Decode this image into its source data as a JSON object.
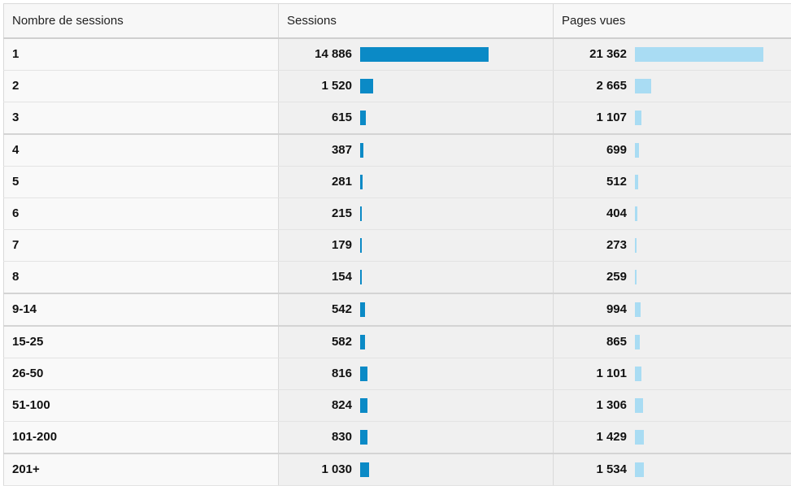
{
  "colors": {
    "sessions_bar": "#0b8ac6",
    "pageviews_bar": "#a9dcf3"
  },
  "table": {
    "headers": [
      "Nombre de sessions",
      "Sessions",
      "Pages vues"
    ],
    "rows": [
      {
        "label": "1",
        "sessions": "14 886",
        "sessions_value": 14886,
        "pageviews": "21 362",
        "pageviews_value": 21362
      },
      {
        "label": "2",
        "sessions": "1 520",
        "sessions_value": 1520,
        "pageviews": "2 665",
        "pageviews_value": 2665
      },
      {
        "label": "3",
        "sessions": "615",
        "sessions_value": 615,
        "pageviews": "1 107",
        "pageviews_value": 1107
      },
      {
        "label": "4",
        "sessions": "387",
        "sessions_value": 387,
        "pageviews": "699",
        "pageviews_value": 699
      },
      {
        "label": "5",
        "sessions": "281",
        "sessions_value": 281,
        "pageviews": "512",
        "pageviews_value": 512
      },
      {
        "label": "6",
        "sessions": "215",
        "sessions_value": 215,
        "pageviews": "404",
        "pageviews_value": 404
      },
      {
        "label": "7",
        "sessions": "179",
        "sessions_value": 179,
        "pageviews": "273",
        "pageviews_value": 273
      },
      {
        "label": "8",
        "sessions": "154",
        "sessions_value": 154,
        "pageviews": "259",
        "pageviews_value": 259
      },
      {
        "label": "9-14",
        "sessions": "542",
        "sessions_value": 542,
        "pageviews": "994",
        "pageviews_value": 994
      },
      {
        "label": "15-25",
        "sessions": "582",
        "sessions_value": 582,
        "pageviews": "865",
        "pageviews_value": 865
      },
      {
        "label": "26-50",
        "sessions": "816",
        "sessions_value": 816,
        "pageviews": "1 101",
        "pageviews_value": 1101
      },
      {
        "label": "51-100",
        "sessions": "824",
        "sessions_value": 824,
        "pageviews": "1 306",
        "pageviews_value": 1306
      },
      {
        "label": "101-200",
        "sessions": "830",
        "sessions_value": 830,
        "pageviews": "1 429",
        "pageviews_value": 1429
      },
      {
        "label": "201+",
        "sessions": "1 030",
        "sessions_value": 1030,
        "pageviews": "1 534",
        "pageviews_value": 1534
      }
    ]
  }
}
